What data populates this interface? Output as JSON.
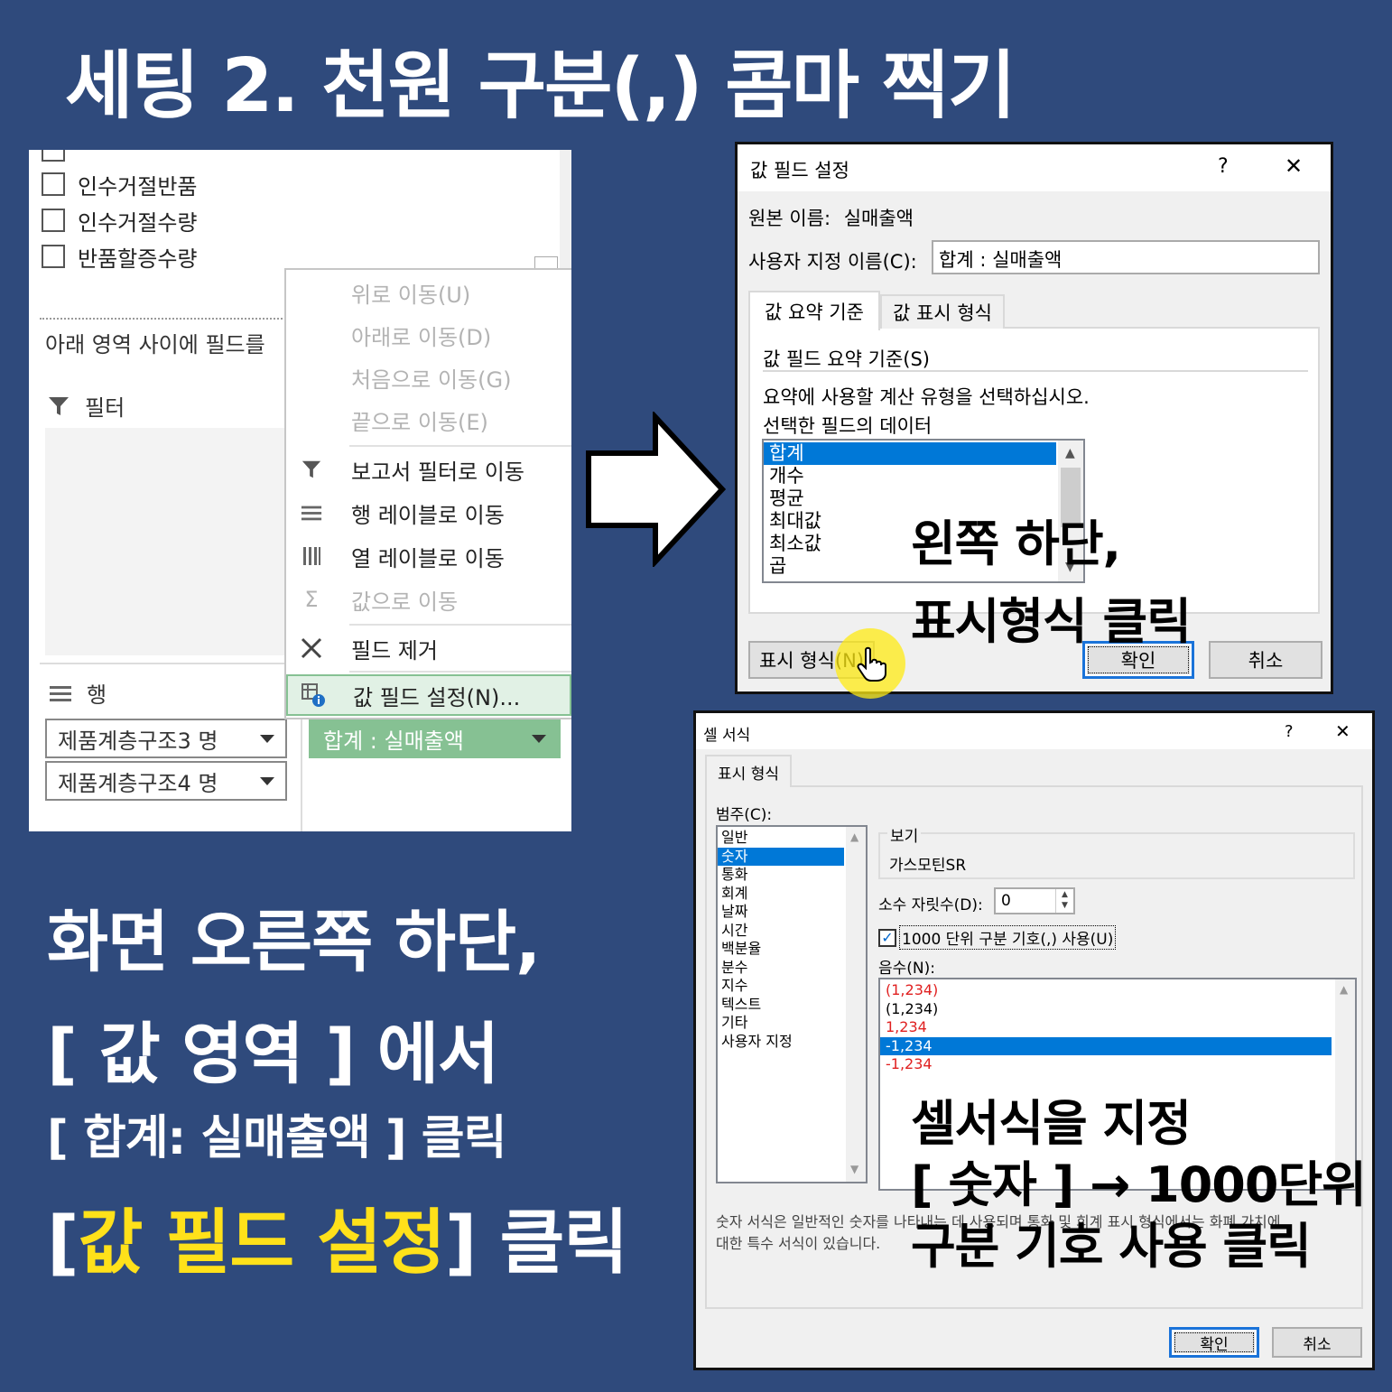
{
  "title": "세팅 2. 천원 구분(,) 콤마 찍기",
  "field_list": {
    "items": [
      "인수거절반품",
      "인수거절수량",
      "반품할증수량"
    ],
    "drag_hint": "아래 영역 사이에 필드를",
    "filter_label": "필터",
    "row_label": "행",
    "row_fields": [
      "제품계층구조3 명",
      "제품계층구조4 명"
    ],
    "value_field": "합계 : 실매출액"
  },
  "context_menu": {
    "items": [
      {
        "label": "위로 이동(U)",
        "icon": "",
        "disabled": true
      },
      {
        "label": "아래로 이동(D)",
        "icon": "",
        "disabled": true
      },
      {
        "label": "처음으로 이동(G)",
        "icon": "",
        "disabled": true
      },
      {
        "label": "끝으로 이동(E)",
        "icon": "",
        "disabled": true
      },
      {
        "label": "보고서 필터로 이동",
        "icon": "filter-icon",
        "disabled": false
      },
      {
        "label": "행 레이블로 이동",
        "icon": "rows-icon",
        "disabled": false
      },
      {
        "label": "열 레이블로 이동",
        "icon": "columns-icon",
        "disabled": false
      },
      {
        "label": "값으로 이동",
        "icon": "sigma-icon",
        "disabled": true
      },
      {
        "label": "필드 제거",
        "icon": "remove-x-icon",
        "disabled": false
      },
      {
        "label": "값 필드 설정(N)...",
        "icon": "value-field-settings-icon",
        "disabled": false
      }
    ]
  },
  "value_field_dialog": {
    "title": "값 필드 설정",
    "help": "?",
    "close": "✕",
    "source_name_label": "원본 이름:",
    "source_name_value": "실매출액",
    "custom_name_label": "사용자 지정 이름(C):",
    "custom_name_value": "합계 : 실매출액",
    "tabs": [
      "값 요약 기준",
      "값 표시 형식"
    ],
    "section_label": "값 필드 요약 기준(S)",
    "instruction": "요약에 사용할 계산 유형을 선택하십시오.",
    "data_label": "선택한 필드의 데이터",
    "calc_types": [
      "합계",
      "개수",
      "평균",
      "최대값",
      "최소값",
      "곱"
    ],
    "number_format_button": "표시 형식(N)",
    "ok": "확인",
    "cancel": "취소",
    "callout_line1": "왼쪽 하단,",
    "callout_line2": "표시형식 클릭"
  },
  "format_cells_dialog": {
    "title": "셀 서식",
    "help": "?",
    "close": "✕",
    "tab": "표시 형식",
    "category_label": "범주(C):",
    "categories": [
      "일반",
      "숫자",
      "통화",
      "회계",
      "날짜",
      "시간",
      "백분율",
      "분수",
      "지수",
      "텍스트",
      "기타",
      "사용자 지정"
    ],
    "sample_label": "보기",
    "sample_value": "가스모틴SR",
    "decimal_label": "소수 자릿수(D):",
    "decimal_value": "0",
    "thousands_label": "1000 단위 구분 기호(,) 사용(U)",
    "negative_label": "음수(N):",
    "negative_options": [
      "(1,234)",
      "(1,234)",
      "1,234",
      "-1,234",
      "-1,234"
    ],
    "description_line1": "숫자 서식은 일반적인 숫자를 나타내는 데 사용되며 통화 및 회계 표시 형식에서는 화폐 가치에",
    "description_line2": "대한 특수 서식이 있습니다.",
    "ok": "확인",
    "cancel": "취소",
    "callout_line1": "셀서식을 지정",
    "callout_line2": "[ 숫자 ] → 1000단위",
    "callout_line3": "구분 기호 사용 클릭"
  },
  "instructions": {
    "line1": "화면 오른쪽 하단,",
    "line2": "[ 값 영역 ] 에서",
    "line3": "[ 합계: 실매출액 ] 클릭",
    "line4_open": "[",
    "line4_highlight": "값 필드 설정",
    "line4_close": "] 클릭"
  },
  "colors": {
    "background": "#2f4a7c",
    "highlight_text": "#ffe11a",
    "selection": "#0078d7",
    "value_chip": "#86c193"
  }
}
